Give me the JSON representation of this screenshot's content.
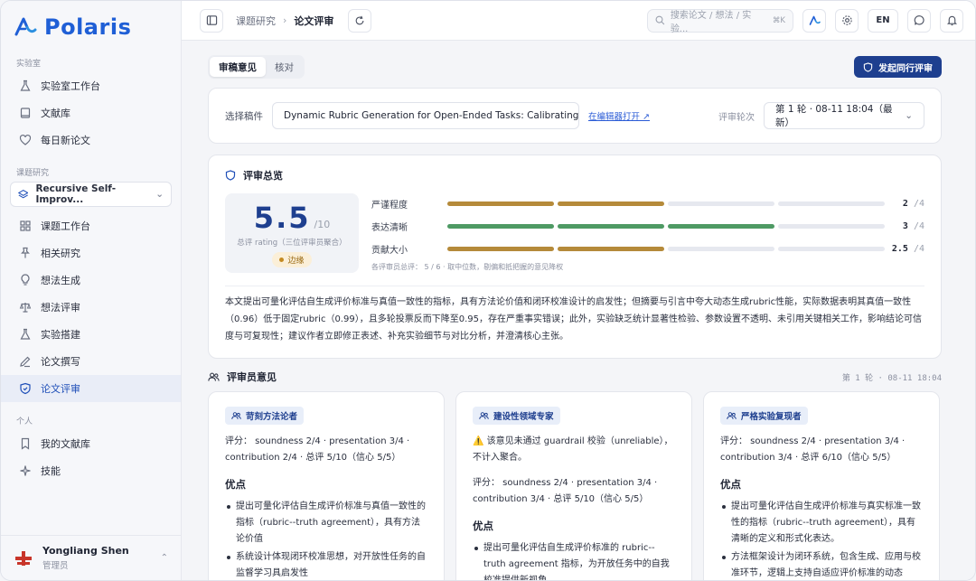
{
  "app": {
    "name": "Polaris"
  },
  "sidebar": {
    "lab_section": "实验室",
    "lab_items": [
      {
        "label": "实验室工作台",
        "icon": "flask-icon"
      },
      {
        "label": "文献库",
        "icon": "book-icon"
      },
      {
        "label": "每日新论文",
        "icon": "heart-icon"
      }
    ],
    "project_section": "课题研究",
    "project_select": "Recursive Self-Improv...",
    "project_items": [
      {
        "label": "课题工作台",
        "icon": "grid-icon"
      },
      {
        "label": "相关研究",
        "icon": "pin-icon"
      },
      {
        "label": "想法生成",
        "icon": "lightbulb-icon"
      },
      {
        "label": "想法评审",
        "icon": "scale-icon"
      },
      {
        "label": "实验搭建",
        "icon": "flask-icon"
      },
      {
        "label": "论文撰写",
        "icon": "pen-icon"
      },
      {
        "label": "论文评审",
        "icon": "shield-icon"
      }
    ],
    "personal_section": "个人",
    "personal_items": [
      {
        "label": "我的文献库",
        "icon": "bookmark-icon"
      },
      {
        "label": "技能",
        "icon": "sparkle-icon"
      }
    ],
    "user": {
      "name": "Yongliang Shen",
      "role": "管理员"
    }
  },
  "topbar": {
    "breadcrumb_parent": "课题研究",
    "breadcrumb_sep": "›",
    "breadcrumb_current": "论文评审",
    "search_placeholder": "搜索论文 / 想法 / 实验...",
    "search_shortcut": "⌘K",
    "lang": "EN"
  },
  "tabs": [
    "审稿意见",
    "核对"
  ],
  "primary_action": "发起同行评审",
  "manuscript": {
    "label": "选择稿件",
    "value": "Dynamic Rubric Generation for Open-Ended Tasks: Calibrating Se",
    "editor_link": "在编辑器打开 ↗",
    "round_label": "评审轮次",
    "round_value": "第 1 轮 · 08-11 18:04（最新）"
  },
  "overview": {
    "title": "评审总览",
    "score": "5.5",
    "score_den": "/10",
    "score_caption": "总评 rating（三位评审员聚合）",
    "verdict": "边缘",
    "metrics": [
      {
        "label": "严谨程度",
        "value": "2",
        "max": "/4",
        "score": 2,
        "color": "#b58a3a"
      },
      {
        "label": "表达清晰",
        "value": "3",
        "max": "/4",
        "score": 3,
        "color": "#4e9a64"
      },
      {
        "label": "贡献大小",
        "value": "2.5",
        "max": "/4",
        "score": 2,
        "color": "#b58a3a"
      }
    ],
    "note": "各评审员总评： 5 / 6 · 取中位数，剔偏和抵把握的意见降权",
    "summary": "本文提出可量化评估自生成评价标准与真值一致性的指标，具有方法论价值和闭环校准设计的启发性；但摘要与引言中夸大动态生成rubric性能，实际数据表明其真值一致性（0.96）低于固定rubric（0.99），且多轮投票反而下降至0.95，存在严重事实错误；此外，实验缺乏统计显著性检验、参数设置不透明、未引用关键相关工作，影响结论可信度与可复现性；建议作者立即修正表述、补充实验细节与对比分析，并澄清核心主张。"
  },
  "reviewers": {
    "title": "评审员意见",
    "round_meta": "第 1 轮 · 08-11 18:04",
    "cards": [
      {
        "tag": "苛刻方法论者",
        "warn": "",
        "score": "评分： soundness 2/4 · presentation 3/4 · contribution 2/4 · 总评 5/10（信心 5/5）",
        "strengths_title": "优点",
        "strengths": [
          "提出可量化评估自生成评价标准与真值一致性的指标（rubric--truth agreement），具有方法论价值",
          "系统设计体现闭环校准思想，对开放性任务的自监督学习具启发性"
        ]
      },
      {
        "tag": "建设性领域专家",
        "warn": "⚠️ 该意见未通过 guardrail 校验（unreliable），不计入聚合。",
        "score": "评分： soundness 2/4 · presentation 3/4 · contribution 3/4 · 总评 5/10（信心 5/5）",
        "strengths_title": "优点",
        "strengths": [
          "提出可量化评估自生成评价标准的 rubric--truth agreement 指标，为开放任务中的自我校准提供新视角"
        ]
      },
      {
        "tag": "严格实验复现者",
        "warn": "",
        "score": "评分： soundness 2/4 · presentation 3/4 · contribution 3/4 · 总评 6/10（信心 5/5）",
        "strengths_title": "优点",
        "strengths": [
          "提出可量化评估自生成评价标准与真实标准一致性的指标（rubric--truth agreement），具有清晰的定义和形式化表达。",
          "方法框架设计为闭环系统，包含生成、应用与校准环节，逻辑上支持自适应评价标准的动态"
        ]
      }
    ]
  }
}
